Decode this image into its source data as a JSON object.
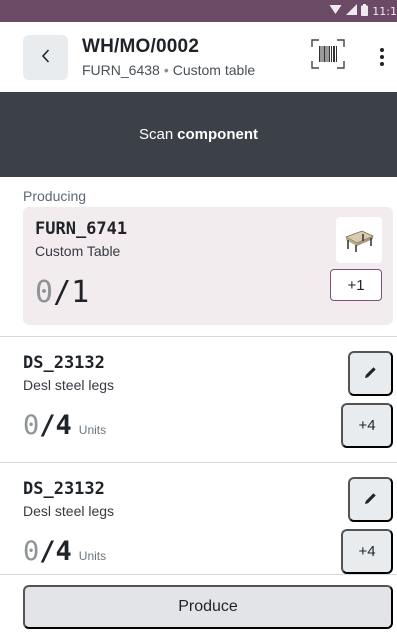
{
  "status_bar": {
    "time": "11:1",
    "icons": [
      "wifi-icon",
      "cellular-signal-icon",
      "battery-icon"
    ],
    "bg_color": "#6b4a66"
  },
  "header": {
    "back_icon": "chevron-left-icon",
    "title": "WH/MO/0002",
    "product_code": "FURN_6438",
    "separator": "•",
    "product_name": "Custom table",
    "barcode_icon": "barcode-scanner-icon",
    "menu_icon": "kebab-menu-icon"
  },
  "scan_banner": {
    "prefix": "Scan",
    "emphasis": "component",
    "bg_color": "#3c4147"
  },
  "producing": {
    "section_label": "Producing",
    "code": "FURN_6741",
    "name": "Custom Table",
    "qty_done": "0",
    "qty_sep": "/",
    "qty_total": "1",
    "image_icon": "product-thumbnail",
    "increment_label": "+1",
    "card_color": "#f2ecef",
    "accent_color": "#7d5176"
  },
  "components": [
    {
      "code": "DS_23132",
      "name": "Desl steel legs",
      "qty_done": "0",
      "qty_sep": "/",
      "qty_total": "4",
      "uom": "Units",
      "edit_icon": "pencil-icon",
      "increment_label": "+4"
    },
    {
      "code": "DS_23132",
      "name": "Desl steel legs",
      "qty_done": "0",
      "qty_sep": "/",
      "qty_total": "4",
      "uom": "Units",
      "edit_icon": "pencil-icon",
      "increment_label": "+4"
    }
  ],
  "footer": {
    "produce_label": "Produce"
  }
}
